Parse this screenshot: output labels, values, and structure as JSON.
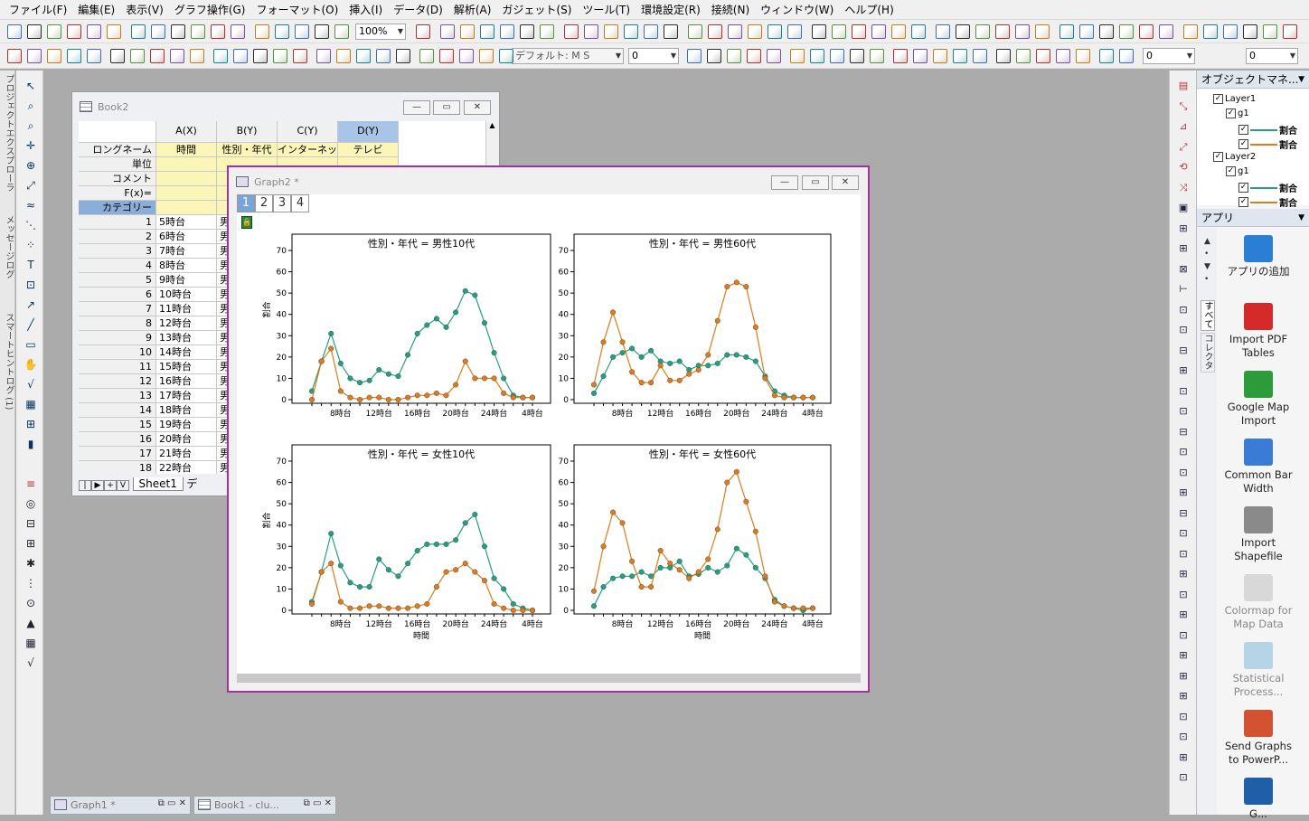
{
  "menu": [
    "ファイル(F)",
    "編集(E)",
    "表示(V)",
    "グラフ操作(G)",
    "フォーマット(O)",
    "挿入(I)",
    "データ(D)",
    "解析(A)",
    "ガジェット(S)",
    "ツール(T)",
    "環境設定(R)",
    "接続(N)",
    "ウィンドウ(W)",
    "ヘルプ(H)"
  ],
  "toolbar": {
    "zoom": "100%",
    "font_name": "デフォルト: M S",
    "font_size": "0",
    "line_value": "0",
    "num2": "0"
  },
  "vtabs": [
    "プロジェクトエクスプローラ",
    "メッセージログ",
    "スマートヒントログ (1)"
  ],
  "object_manager": {
    "title": "オブジェクトマネ...",
    "rows": [
      {
        "indent": 0,
        "label": "Layer1"
      },
      {
        "indent": 1,
        "label": "g1"
      },
      {
        "indent": 2,
        "label": "割合"
      },
      {
        "indent": 2,
        "label": "割合"
      },
      {
        "indent": 0,
        "label": "Layer2"
      },
      {
        "indent": 1,
        "label": "g1"
      },
      {
        "indent": 2,
        "label": "割合"
      },
      {
        "indent": 2,
        "label": "割合"
      }
    ]
  },
  "apps_panel": {
    "title": "アプリ",
    "side_tabs": [
      "すべて",
      "コレクタ"
    ],
    "apps": [
      {
        "label": "アプリの追加",
        "icon": "add-app-icon",
        "color": "#2a7fd4",
        "enabled": true
      },
      {
        "label": "Import PDF Tables",
        "icon": "pdf-icon",
        "color": "#d42a2a",
        "enabled": true
      },
      {
        "label": "Google Map Import",
        "icon": "map-pin-icon",
        "color": "#2e9b3a",
        "enabled": true
      },
      {
        "label": "Common Bar Width",
        "icon": "bar-width-icon",
        "color": "#3a7bd5",
        "enabled": true
      },
      {
        "label": "Import Shapefile",
        "icon": "shapefile-icon",
        "color": "#8a8a8a",
        "enabled": true
      },
      {
        "label": "Colormap for Map Data",
        "icon": "colormap-icon",
        "color": "#c0c0c0",
        "enabled": false
      },
      {
        "label": "Statistical Process...",
        "icon": "spc-icon",
        "color": "#7fb8d8",
        "enabled": false
      },
      {
        "label": "Send Graphs to PowerP...",
        "icon": "powerpoint-icon",
        "color": "#d35230",
        "enabled": true
      },
      {
        "label": "G...",
        "icon": "edit-app-icon",
        "color": "#1e5fa8",
        "enabled": true
      }
    ]
  },
  "book2": {
    "title": "Book2",
    "columns": [
      "A(X)",
      "B(Y)",
      "C(Y)",
      "D(Y)"
    ],
    "header_rows": [
      {
        "label": "ロングネーム",
        "values": [
          "時間",
          "性別・年代",
          "インターネッ",
          "テレビ"
        ]
      },
      {
        "label": "単位",
        "values": [
          "",
          "",
          "",
          ""
        ]
      },
      {
        "label": "コメント",
        "values": [
          "",
          "",
          "",
          ""
        ]
      },
      {
        "label": "F(x)=",
        "values": [
          "",
          "",
          "",
          ""
        ]
      },
      {
        "label": "カテゴリー",
        "values": [
          "",
          "",
          "",
          ""
        ]
      }
    ],
    "rows": [
      [
        "1",
        "5時台",
        "男"
      ],
      [
        "2",
        "6時台",
        "男"
      ],
      [
        "3",
        "7時台",
        "男"
      ],
      [
        "4",
        "8時台",
        "男"
      ],
      [
        "5",
        "9時台",
        "男"
      ],
      [
        "6",
        "10時台",
        "男"
      ],
      [
        "7",
        "11時台",
        "男"
      ],
      [
        "8",
        "12時台",
        "男"
      ],
      [
        "9",
        "13時台",
        "男"
      ],
      [
        "10",
        "14時台",
        "男"
      ],
      [
        "11",
        "15時台",
        "男"
      ],
      [
        "12",
        "16時台",
        "男"
      ],
      [
        "13",
        "17時台",
        "男"
      ],
      [
        "14",
        "18時台",
        "男"
      ],
      [
        "15",
        "19時台",
        "男"
      ],
      [
        "16",
        "20時台",
        "男"
      ],
      [
        "17",
        "21時台",
        "男"
      ],
      [
        "18",
        "22時台",
        "男"
      ]
    ],
    "sheet_tab": "Sheet1",
    "sheet_tab2": "デ"
  },
  "graph2": {
    "title": "Graph2 *",
    "page_tabs": [
      "1",
      "2",
      "3",
      "4"
    ]
  },
  "taskbar": [
    {
      "label": "Graph1 *"
    },
    {
      "label": "Book1 - clu..."
    }
  ],
  "chart_data": [
    {
      "type": "line",
      "title": "性別・年代 = 男性10代",
      "xlabel": "",
      "ylabel": "割合",
      "ylim": [
        0,
        70
      ],
      "x_tick_labels": [
        "8時台",
        "12時台",
        "16時台",
        "20時台",
        "24時台",
        "4時台"
      ],
      "series": [
        {
          "color": "#22a081",
          "values": [
            4,
            18,
            31,
            17,
            10,
            8,
            9,
            14,
            12,
            11,
            21,
            31,
            35,
            38,
            34,
            41,
            51,
            49,
            36,
            22,
            10,
            2,
            1,
            1
          ]
        },
        {
          "color": "#e07b1a",
          "values": [
            0,
            18,
            24,
            4,
            1,
            0,
            1,
            1,
            0,
            0,
            1,
            2,
            2,
            3,
            2,
            7,
            18,
            10,
            10,
            10,
            3,
            1,
            1,
            1
          ]
        }
      ]
    },
    {
      "type": "line",
      "title": "性別・年代 = 男性60代",
      "xlabel": "",
      "ylabel": "",
      "ylim": [
        0,
        70
      ],
      "x_tick_labels": [
        "8時台",
        "12時台",
        "16時台",
        "20時台",
        "24時台",
        "4時台"
      ],
      "series": [
        {
          "color": "#22a081",
          "values": [
            3,
            11,
            20,
            22,
            24,
            20,
            23,
            18,
            17,
            18,
            14,
            16,
            16,
            17,
            21,
            21,
            20,
            18,
            11,
            4,
            2,
            1,
            1,
            1
          ]
        },
        {
          "color": "#e07b1a",
          "values": [
            7,
            27,
            41,
            27,
            13,
            8,
            8,
            16,
            9,
            9,
            12,
            14,
            21,
            37,
            53,
            55,
            53,
            34,
            10,
            2,
            1,
            1,
            1,
            1
          ]
        }
      ]
    },
    {
      "type": "line",
      "title": "性別・年代 = 女性10代",
      "xlabel": "時間",
      "ylabel": "割合",
      "ylim": [
        0,
        70
      ],
      "x_tick_labels": [
        "8時台",
        "12時台",
        "16時台",
        "20時台",
        "24時台",
        "4時台"
      ],
      "series": [
        {
          "color": "#22a081",
          "values": [
            4,
            18,
            36,
            21,
            13,
            11,
            11,
            24,
            19,
            16,
            22,
            28,
            31,
            31,
            31,
            33,
            41,
            45,
            30,
            15,
            10,
            3,
            1,
            0
          ]
        },
        {
          "color": "#e07b1a",
          "values": [
            3,
            18,
            22,
            4,
            1,
            1,
            2,
            2,
            1,
            1,
            1,
            2,
            3,
            11,
            18,
            19,
            22,
            18,
            14,
            3,
            1,
            0,
            0,
            0
          ]
        }
      ]
    },
    {
      "type": "line",
      "title": "性別・年代 = 女性60代",
      "xlabel": "時間",
      "ylabel": "",
      "ylim": [
        0,
        70
      ],
      "x_tick_labels": [
        "8時台",
        "12時台",
        "16時台",
        "20時台",
        "24時台",
        "4時台"
      ],
      "series": [
        {
          "color": "#22a081",
          "values": [
            2,
            11,
            15,
            16,
            16,
            18,
            16,
            20,
            20,
            23,
            16,
            17,
            20,
            18,
            21,
            29,
            26,
            20,
            15,
            5,
            2,
            1,
            0,
            1
          ]
        },
        {
          "color": "#e07b1a",
          "values": [
            9,
            30,
            46,
            41,
            23,
            11,
            11,
            28,
            22,
            19,
            15,
            18,
            24,
            38,
            60,
            65,
            51,
            37,
            16,
            4,
            2,
            1,
            1,
            1
          ]
        }
      ]
    }
  ]
}
